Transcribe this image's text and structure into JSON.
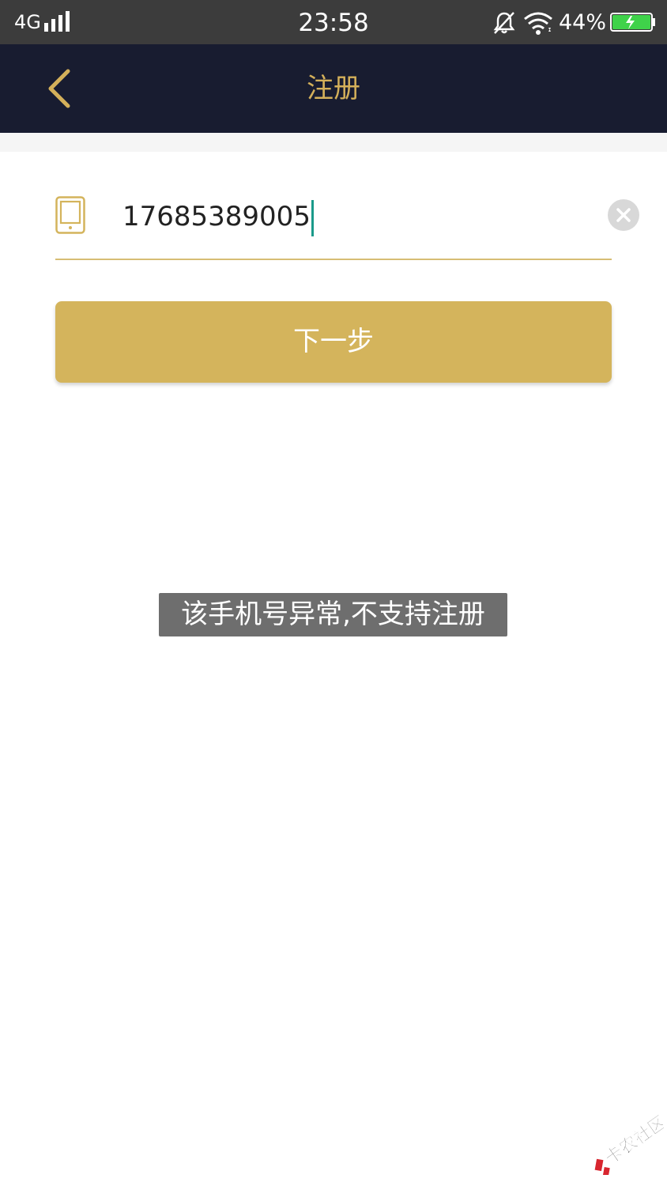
{
  "status_bar": {
    "network": "4G",
    "time": "23:58",
    "battery_percent": "44%",
    "battery_level": 0.44,
    "charging": true,
    "icons": [
      "signal-icon",
      "bell-muted-icon",
      "wifi-icon",
      "battery-charging-icon"
    ]
  },
  "nav": {
    "title": "注册",
    "back_icon": "chevron-left-icon"
  },
  "phone_input": {
    "value": "17685389005",
    "icon": "mobile-phone-icon",
    "clear_icon": "clear-circle-icon"
  },
  "next_button": {
    "label": "下一步"
  },
  "toast": {
    "message": "该手机号异常,不支持注册"
  },
  "watermark": {
    "text": "卡农社区"
  },
  "colors": {
    "nav_background": "#181c30",
    "accent_gold": "#d4b45c",
    "status_bar": "#3c3c3c",
    "caret": "#1a9a8a",
    "toast_background": "#6e6e6e"
  }
}
